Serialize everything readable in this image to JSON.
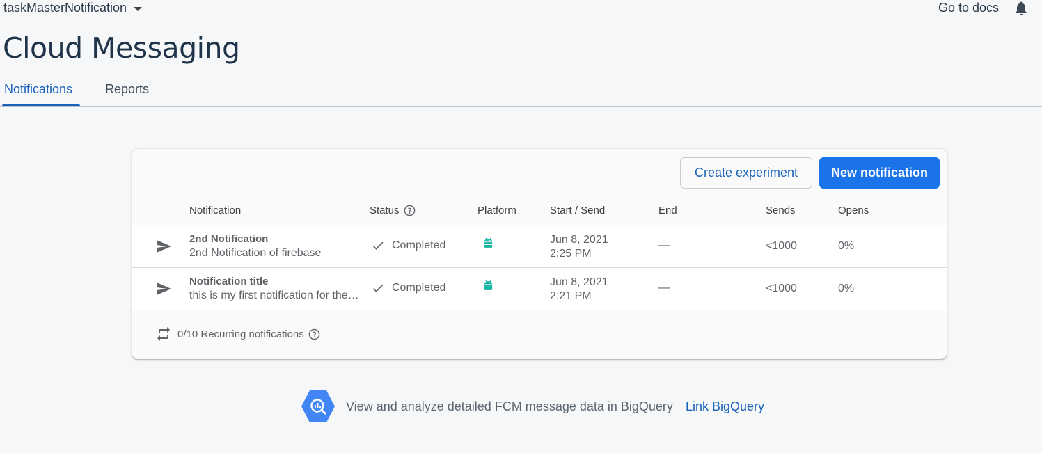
{
  "header": {
    "project_name": "taskMasterNotification",
    "docs_link": "Go to docs",
    "bell_icon": "notifications-bell-icon"
  },
  "page_title": "Cloud Messaging",
  "tabs": [
    {
      "label": "Notifications",
      "active": true
    },
    {
      "label": "Reports",
      "active": false
    }
  ],
  "card": {
    "create_experiment_label": "Create experiment",
    "new_notification_label": "New notification",
    "columns": [
      "Notification",
      "Status",
      "Platform",
      "Start / Send",
      "End",
      "Sends",
      "Opens"
    ],
    "rows": [
      {
        "title": "2nd Notification",
        "subtitle": "2nd Notification of firebase",
        "status": "Completed",
        "platform": "android-icon",
        "start_date": "Jun 8, 2021",
        "start_time": "2:25 PM",
        "end": "—",
        "sends": "<1000",
        "opens": "0%"
      },
      {
        "title": "Notification title",
        "subtitle": "this is my first notification for the…",
        "status": "Completed",
        "platform": "android-icon",
        "start_date": "Jun 8, 2021",
        "start_time": "2:21 PM",
        "end": "—",
        "sends": "<1000",
        "opens": "0%"
      }
    ],
    "recurring_text": "0/10 Recurring notifications"
  },
  "footer": {
    "bigquery_text": "View and analyze detailed FCM message data in BigQuery",
    "bigquery_link": "Link BigQuery"
  },
  "colors": {
    "accent": "#1a73e8",
    "link": "#1a62b8",
    "android": "#3ddc84",
    "bigquery": "#4285f4"
  }
}
